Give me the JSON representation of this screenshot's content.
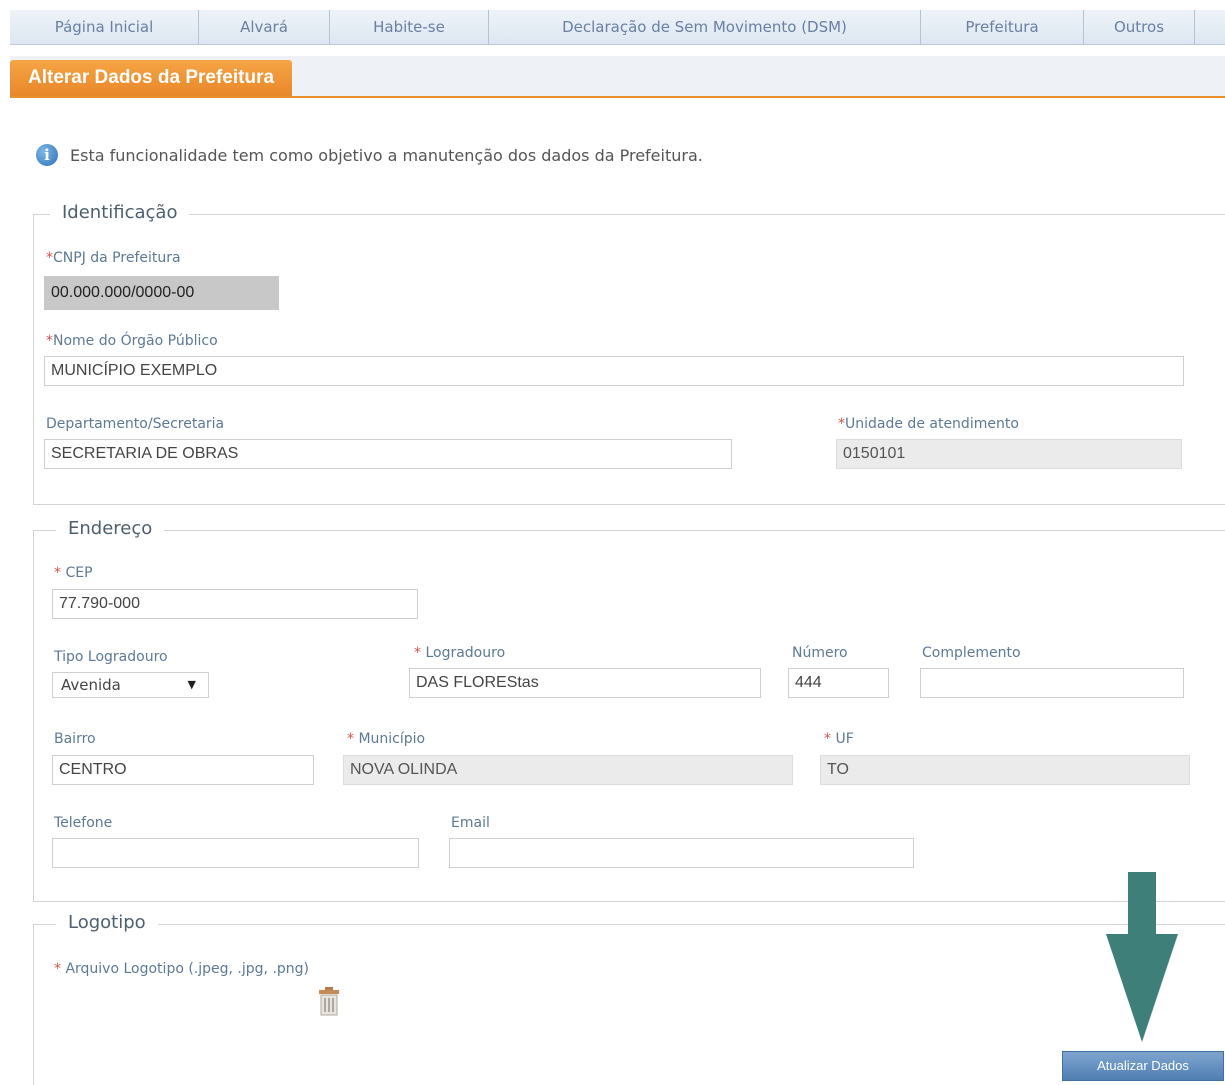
{
  "nav": {
    "items": [
      {
        "label": "Página Inicial"
      },
      {
        "label": "Alvará"
      },
      {
        "label": "Habite-se"
      },
      {
        "label": "Declaração de Sem Movimento (DSM)"
      },
      {
        "label": "Prefeitura"
      },
      {
        "label": "Outros"
      }
    ]
  },
  "header": {
    "title": "Alterar Dados da Prefeitura"
  },
  "info": {
    "text": "Esta funcionalidade tem como objetivo a manutenção dos dados da Prefeitura."
  },
  "identificacao": {
    "legend": "Identificação",
    "cnpj_label": "CNPJ da Prefeitura",
    "cnpj_value": "00.000.000/0000-00",
    "nome_label": "Nome do Órgão Público",
    "nome_value": "MUNICÍPIO EXEMPLO",
    "departamento_label": "Departamento/Secretaria",
    "departamento_value": "SECRETARIA DE OBRAS",
    "unidade_label": "Unidade de atendimento",
    "unidade_value": "0150101"
  },
  "endereco": {
    "legend": "Endereço",
    "cep_label": " CEP",
    "cep_value": "77.790-000",
    "tipo_label": "Tipo Logradouro",
    "tipo_value": "Avenida",
    "logradouro_label": " Logradouro",
    "logradouro_value": "DAS FLOREStas",
    "numero_label": "Número",
    "numero_value": "444",
    "complemento_label": "Complemento",
    "complemento_value": "",
    "bairro_label": "Bairro",
    "bairro_value": "CENTRO",
    "municipio_label": " Município",
    "municipio_value": "NOVA OLINDA",
    "uf_label": " UF",
    "uf_value": "TO",
    "telefone_label": "Telefone",
    "telefone_value": "",
    "email_label": "Email",
    "email_value": ""
  },
  "logotipo": {
    "legend": "Logotipo",
    "arquivo_label": " Arquivo Logotipo (.jpeg, .jpg, .png)"
  },
  "actions": {
    "update_label": "Atualizar Dados"
  },
  "colors": {
    "accent_orange": "#e8922f",
    "arrow_teal": "#3e7f7a",
    "button_blue": "#5b88bb"
  }
}
